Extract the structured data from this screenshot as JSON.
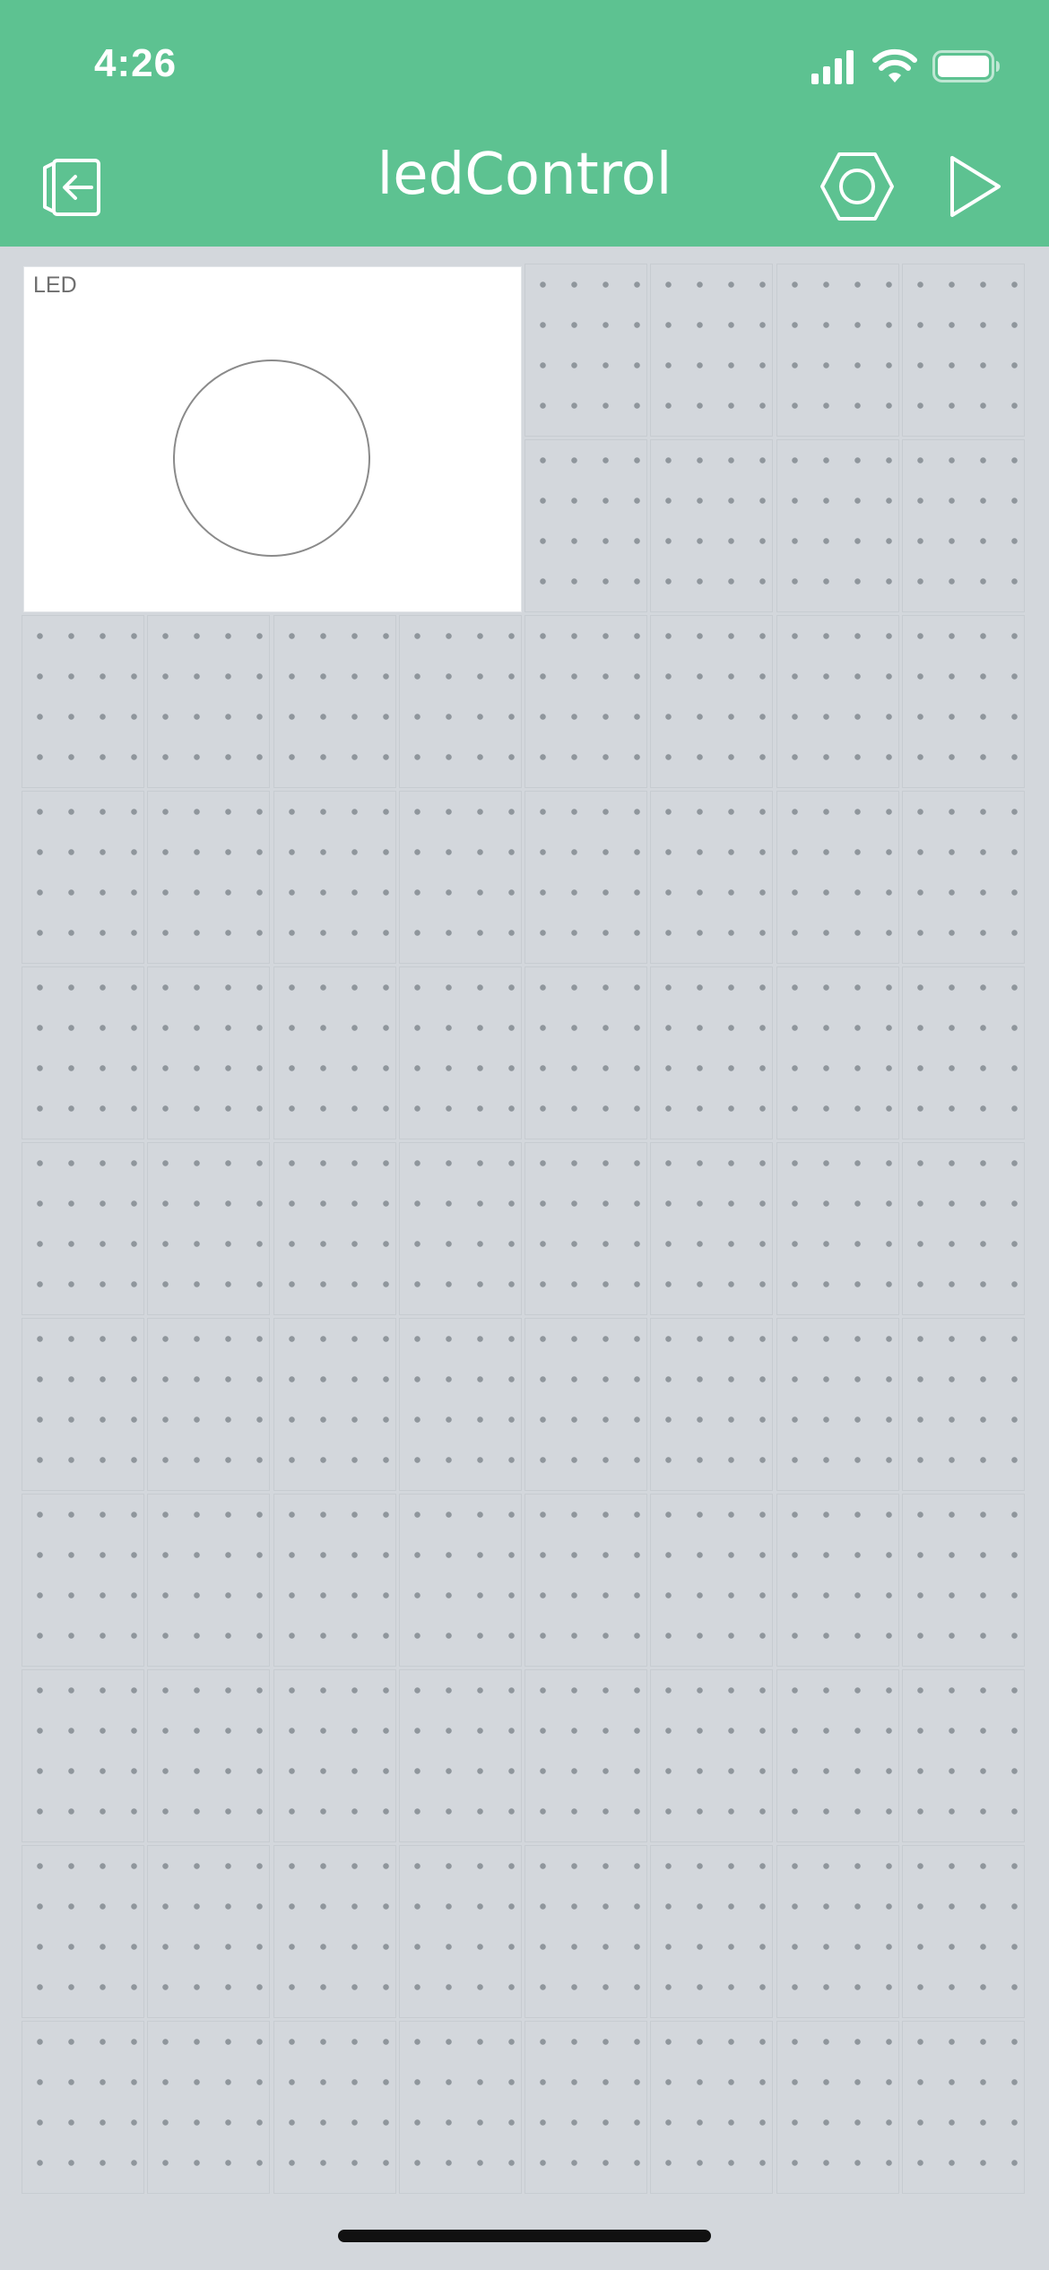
{
  "status_bar": {
    "time": "4:26",
    "icons": [
      "signal-icon",
      "wifi-icon",
      "battery-icon"
    ]
  },
  "header": {
    "title": "ledControl",
    "background_color": "#5dc291",
    "left_button_icon": "exit-project-icon",
    "right_buttons": [
      "settings-hex-nut-icon",
      "play-icon"
    ]
  },
  "canvas": {
    "columns": 8,
    "rows": 11,
    "background_color": "#d3d7dc"
  },
  "widgets": [
    {
      "type": "led",
      "label": "LED",
      "state": "off"
    }
  ]
}
